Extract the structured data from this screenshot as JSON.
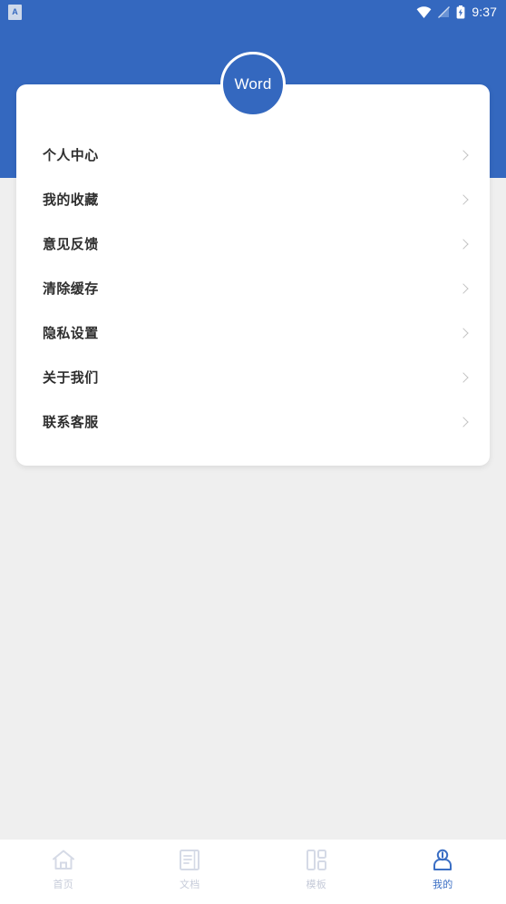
{
  "status_bar": {
    "notification_icon": "app-notification-icon",
    "notification_glyph": "A",
    "wifi_icon": "wifi-icon",
    "signal_icon": "signal-off-icon",
    "battery_icon": "battery-charging-icon",
    "time": "9:37"
  },
  "header": {
    "background_color": "#3468bf"
  },
  "avatar": {
    "label": "Word",
    "fill_color": "#3468bf",
    "border_color": "#ffffff"
  },
  "menu": {
    "items": [
      {
        "label": "个人中心",
        "name": "menu-item-personal-center",
        "chevron": "chevron-right-icon"
      },
      {
        "label": "我的收藏",
        "name": "menu-item-my-favorites",
        "chevron": "chevron-right-icon"
      },
      {
        "label": "意见反馈",
        "name": "menu-item-feedback",
        "chevron": "chevron-right-icon"
      },
      {
        "label": "清除缓存",
        "name": "menu-item-clear-cache",
        "chevron": "chevron-right-icon"
      },
      {
        "label": "隐私设置",
        "name": "menu-item-privacy-settings",
        "chevron": "chevron-right-icon"
      },
      {
        "label": "关于我们",
        "name": "menu-item-about-us",
        "chevron": "chevron-right-icon"
      },
      {
        "label": "联系客服",
        "name": "menu-item-contact-support",
        "chevron": "chevron-right-icon"
      }
    ]
  },
  "bottom_nav": {
    "active_color": "#3a6ec4",
    "inactive_color": "#c6cbd9",
    "tabs": [
      {
        "label": "首页",
        "icon": "home-icon",
        "active": false
      },
      {
        "label": "文档",
        "icon": "document-icon",
        "active": false
      },
      {
        "label": "模板",
        "icon": "template-grid-icon",
        "active": false
      },
      {
        "label": "我的",
        "icon": "person-icon",
        "active": true
      }
    ]
  }
}
